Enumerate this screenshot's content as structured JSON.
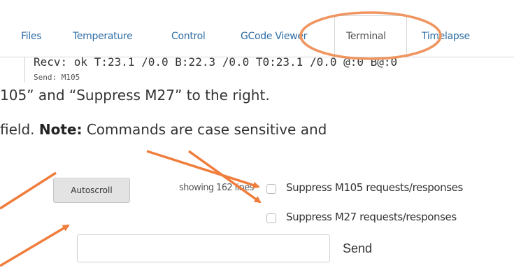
{
  "tabs": [
    {
      "label": "Files"
    },
    {
      "label": "Temperature"
    },
    {
      "label": "Control"
    },
    {
      "label": "GCode Viewer"
    },
    {
      "label": "Terminal",
      "active": true
    },
    {
      "label": "Timelapse"
    }
  ],
  "terminal": {
    "line1": "Recv: ok T:23.1 /0.0 B:22.3 /0.0 T0:23.1 /0.0 @:0 B@:0",
    "line2": "Send: M105"
  },
  "instructions": {
    "line1": "105” and “Suppress M27” to the right.",
    "line2_prefix": "field. ",
    "line2_note": "Note:",
    "line2_suffix": " Commands are case sensitive and"
  },
  "controls": {
    "autoscroll_label": "Autoscroll",
    "showing_text": "showing 162 lines",
    "suppress_m105_label": "Suppress M105 requests/responses",
    "suppress_m105_checked": false,
    "suppress_m27_label": "Suppress M27 requests/responses",
    "suppress_m27_checked": false,
    "command_value": "",
    "send_label": "Send"
  },
  "annotations": {
    "highlight_color": "#f0955f",
    "arrow_color": "#f07d3c"
  }
}
